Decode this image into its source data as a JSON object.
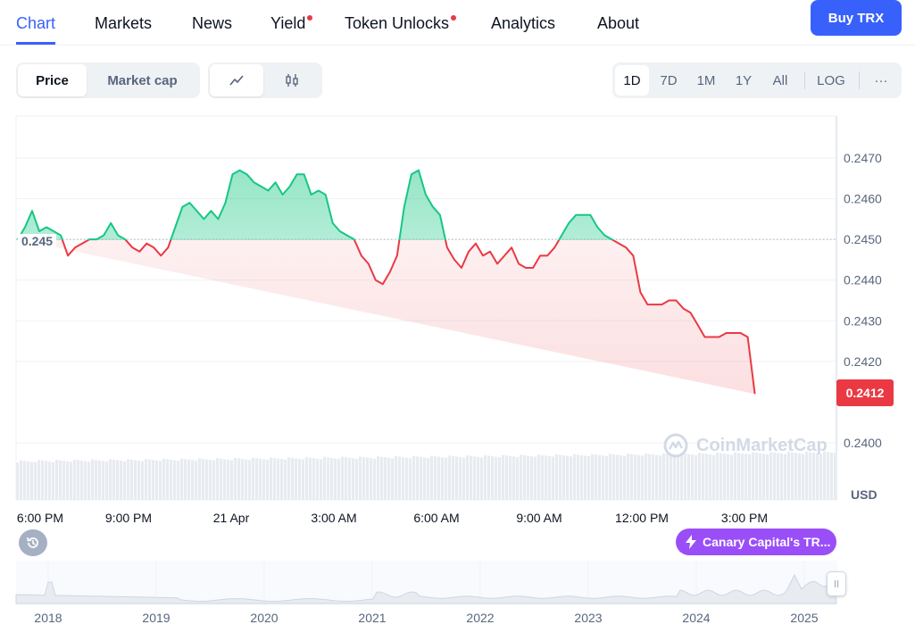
{
  "nav": {
    "tabs": [
      {
        "label": "Chart",
        "active": true,
        "dot": false
      },
      {
        "label": "Markets",
        "active": false,
        "dot": false
      },
      {
        "label": "News",
        "active": false,
        "dot": false
      },
      {
        "label": "Yield",
        "active": false,
        "dot": true
      },
      {
        "label": "Token Unlocks",
        "active": false,
        "dot": true
      },
      {
        "label": "Analytics",
        "active": false,
        "dot": false
      },
      {
        "label": "About",
        "active": false,
        "dot": false
      }
    ],
    "buy_label": "Buy TRX"
  },
  "controls": {
    "price_label": "Price",
    "marketcap_label": "Market cap",
    "line_icon": "line-chart-icon",
    "candle_icon": "candlestick-icon",
    "ranges": [
      "1D",
      "7D",
      "1M",
      "1Y",
      "All"
    ],
    "active_range": "1D",
    "log_label": "LOG",
    "more_label": "···"
  },
  "colors": {
    "up": "#16c784",
    "down": "#ea3943",
    "accent": "#3861fb",
    "news": "#9a4ef8"
  },
  "chart_data": {
    "type": "area",
    "yticks": [
      "0.2470",
      "0.2460",
      "0.2450",
      "0.2440",
      "0.2430",
      "0.2420",
      "0.2400"
    ],
    "ylim": [
      0.24,
      0.2473
    ],
    "reference_value": 0.245,
    "reference_label": "0.245",
    "current_price": "0.2412",
    "currency": "USD",
    "xticks": [
      "6:00 PM",
      "9:00 PM",
      "21 Apr",
      "3:00 AM",
      "6:00 AM",
      "9:00 AM",
      "12:00 PM",
      "3:00 PM"
    ],
    "x_hours": [
      0,
      3,
      6,
      9,
      12,
      15,
      18,
      21
    ],
    "x": [
      0.0,
      0.21,
      0.42,
      0.63,
      0.84,
      1.05,
      1.26,
      1.47,
      1.68,
      1.89,
      2.1,
      2.31,
      2.52,
      2.73,
      2.94,
      3.15,
      3.36,
      3.57,
      3.78,
      3.99,
      4.2,
      4.41,
      4.62,
      4.83,
      5.04,
      5.25,
      5.46,
      5.67,
      5.88,
      6.09,
      6.3,
      6.51,
      6.72,
      6.93,
      7.14,
      7.35,
      7.56,
      7.77,
      7.98,
      8.19,
      8.4,
      8.61,
      8.82,
      9.03,
      9.24,
      9.45,
      9.66,
      9.87,
      10.08,
      10.29,
      10.5,
      10.71,
      10.92,
      11.13,
      11.34,
      11.55,
      11.76,
      11.97,
      12.18,
      12.39,
      12.6,
      12.81,
      13.02,
      13.23,
      13.44,
      13.65,
      13.86,
      14.07,
      14.28,
      14.49,
      14.7,
      14.91,
      15.12,
      15.33,
      15.54,
      15.75,
      15.96,
      16.17,
      16.38,
      16.59,
      16.8,
      17.01,
      17.22,
      17.43,
      17.64,
      17.85,
      18.06,
      18.27,
      18.48,
      18.69,
      18.9,
      19.11,
      19.32,
      19.53,
      19.74,
      19.95,
      20.16,
      20.37,
      20.58,
      20.79,
      21.0,
      21.21,
      21.42,
      21.63,
      21.84,
      22.05,
      22.26,
      22.47,
      22.68,
      22.89,
      23.1,
      23.31,
      23.52,
      23.73,
      23.94,
      24.0
    ],
    "values": [
      0.245,
      0.2453,
      0.2457,
      0.2452,
      0.2453,
      0.2452,
      0.2451,
      0.2446,
      0.2448,
      0.2449,
      0.245,
      0.245,
      0.2451,
      0.2454,
      0.2451,
      0.245,
      0.2448,
      0.2447,
      0.2449,
      0.2448,
      0.2446,
      0.2448,
      0.2453,
      0.2458,
      0.2459,
      0.2457,
      0.2455,
      0.2457,
      0.2455,
      0.2459,
      0.2466,
      0.2467,
      0.2466,
      0.2464,
      0.2463,
      0.2462,
      0.2464,
      0.2461,
      0.2463,
      0.2466,
      0.2466,
      0.2461,
      0.2462,
      0.2461,
      0.2454,
      0.2452,
      0.2451,
      0.245,
      0.2446,
      0.2444,
      0.244,
      0.2439,
      0.2442,
      0.2446,
      0.2458,
      0.2466,
      0.2467,
      0.2461,
      0.2458,
      0.2456,
      0.2448,
      0.2445,
      0.2443,
      0.2447,
      0.2449,
      0.2446,
      0.2447,
      0.2444,
      0.2446,
      0.2448,
      0.2444,
      0.2443,
      0.2443,
      0.2446,
      0.2446,
      0.2448,
      0.2451,
      0.2454,
      0.2456,
      0.2456,
      0.2456,
      0.2453,
      0.2451,
      0.245,
      0.2449,
      0.2448,
      0.2446,
      0.2437,
      0.2434,
      0.2434,
      0.2434,
      0.2435,
      0.2435,
      0.2433,
      0.2432,
      0.2429,
      0.2426,
      0.2426,
      0.2426,
      0.2427,
      0.2427,
      0.2427,
      0.2426,
      0.2412
    ],
    "navigator_years": [
      "2018",
      "2019",
      "2020",
      "2021",
      "2022",
      "2023",
      "2024",
      "2025"
    ],
    "watermark": "CoinMarketCap"
  },
  "news_pill": {
    "label": "Canary Capital's TR...",
    "icon": "lightning-icon"
  },
  "history_icon": "history-icon",
  "handle_icon": "grip-icon"
}
